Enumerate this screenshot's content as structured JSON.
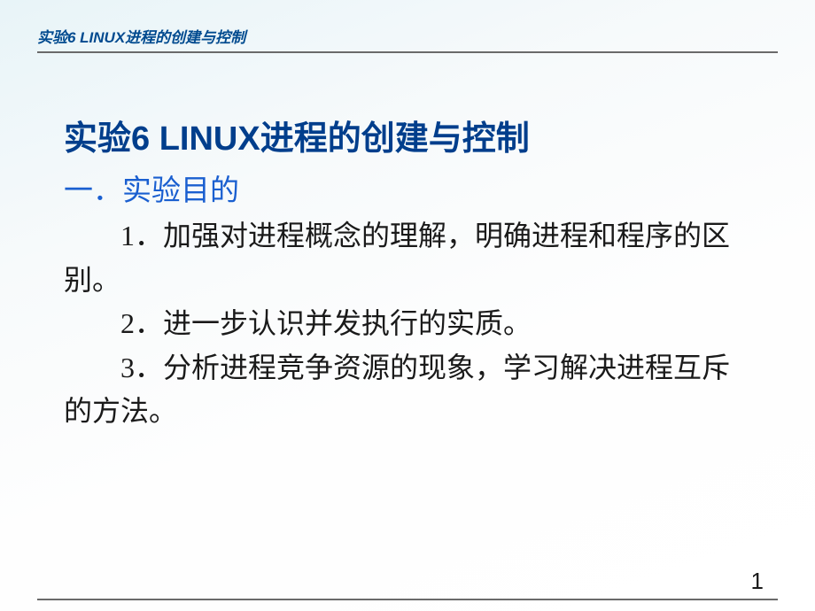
{
  "header": {
    "text": "实验6  LINUX进程的创建与控制"
  },
  "title": "实验6  LINUX进程的创建与控制",
  "section_header": "一．实验目的",
  "items": [
    "1．加强对进程概念的理解，明确进程和程序的区别。",
    "2．进一步认识并发执行的实质。",
    "3．分析进程竞争资源的现象，学习解决进程互斥的方法。"
  ],
  "page_number": "1"
}
